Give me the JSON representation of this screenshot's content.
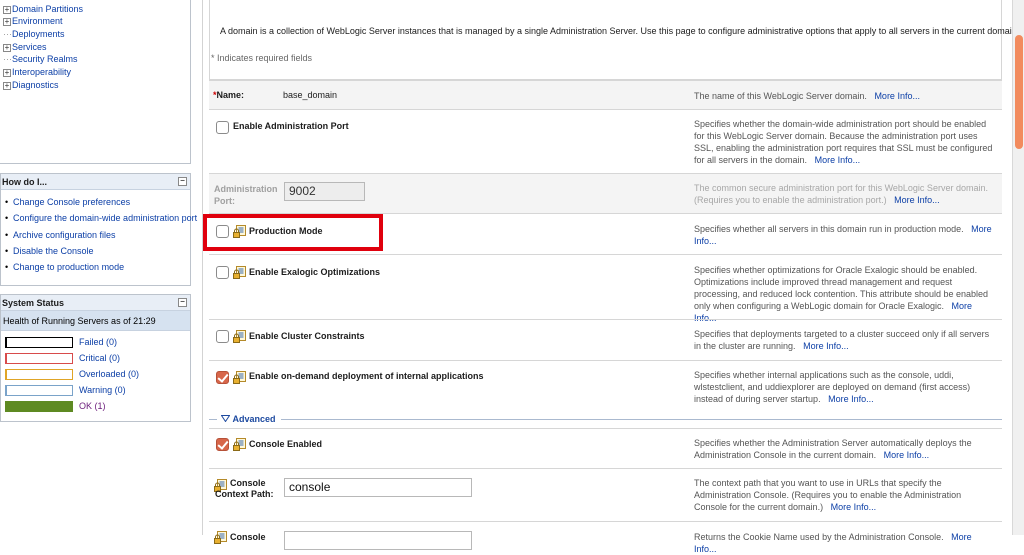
{
  "tree": {
    "items": [
      {
        "label": "Domain Partitions",
        "expandable": true
      },
      {
        "label": "Environment",
        "expandable": true
      },
      {
        "label": "Deployments",
        "expandable": false
      },
      {
        "label": "Services",
        "expandable": true
      },
      {
        "label": "Security Realms",
        "expandable": false
      },
      {
        "label": "Interoperability",
        "expandable": true
      },
      {
        "label": "Diagnostics",
        "expandable": true
      }
    ],
    "expand_glyph": "+",
    "dots_glyph": "···"
  },
  "howdo": {
    "title": "How do I...",
    "collapse_glyph": "−",
    "bullet": "•",
    "links": [
      "Change Console preferences",
      "Configure the domain-wide administration port",
      "Archive configuration files",
      "Disable the Console",
      "Change to production mode"
    ]
  },
  "system_status": {
    "title": "System Status",
    "collapse_glyph": "−",
    "health_label": "Health of Running Servers as of  21:29",
    "rows": [
      {
        "label": "Failed (0)",
        "color": "#000000",
        "fill": 0
      },
      {
        "label": "Critical (0)",
        "color": "#d84b4b",
        "fill": 0
      },
      {
        "label": "Overloaded (0)",
        "color": "#e0a526",
        "fill": 0
      },
      {
        "label": "Warning (0)",
        "color": "#7aa3c9",
        "fill": 0
      },
      {
        "label": "OK (1)",
        "color": "#5e8a22",
        "fill": 1
      }
    ]
  },
  "intro": {
    "text": "A domain is a collection of WebLogic Server instances that is managed by a single Administration Server. Use this page to configure administrative options that apply to all servers in the current domain.",
    "required_note": "* Indicates required fields"
  },
  "more_info": "More Info...",
  "fields": {
    "name": {
      "label": "Name:",
      "required_mark": "*",
      "value": "base_domain",
      "desc": "The name of this WebLogic Server domain."
    },
    "admin_port_enabled": {
      "label": "Enable Administration Port",
      "checked": false,
      "desc": "Specifies whether the domain-wide administration port should be enabled for this WebLogic Server domain. Because the administration port uses SSL, enabling the administration port requires that SSL must be configured for all servers in the domain."
    },
    "admin_port": {
      "label": "Administration Port:",
      "value": "9002",
      "disabled": true,
      "desc": "The common secure administration port for this WebLogic Server domain. (Requires you to enable the administration port.)"
    },
    "production_mode": {
      "label": "Production Mode",
      "checked": false,
      "desc": "Specifies whether all servers in this domain run in production mode."
    },
    "exalogic": {
      "label": "Enable Exalogic Optimizations",
      "checked": false,
      "desc": "Specifies whether optimizations for Oracle Exalogic should be enabled. Optimizations include improved thread management and request processing, and reduced lock contention. This attribute should be enabled only when configuring a WebLogic domain for Oracle Exalogic."
    },
    "cluster_constraints": {
      "label": "Enable Cluster Constraints",
      "checked": false,
      "desc": "Specifies that deployments targeted to a cluster succeed only if all servers in the cluster are running."
    },
    "on_demand": {
      "label": "Enable on-demand deployment of internal applications",
      "checked": true,
      "desc": "Specifies whether internal applications such as the console, uddi, wlstestclient, and uddiexplorer are deployed on demand (first access) instead of during server startup."
    },
    "advanced_label": "Advanced",
    "console_enabled": {
      "label": "Console Enabled",
      "checked": true,
      "desc": "Specifies whether the Administration Server automatically deploys the Administration Console in the current domain."
    },
    "console_context_path": {
      "label": "Console Context Path:",
      "value": "console",
      "desc": "The context path that you want to use in URLs that specify the Administration Console. (Requires you to enable the Administration Console for the current domain.)"
    },
    "console_cookie": {
      "label": "Console",
      "desc": "Returns the Cookie Name used by the Administration Console."
    }
  },
  "colors": {
    "highlight": "#e0000d",
    "checked": "#d7664a",
    "link": "#0b3ea6",
    "scroll_thumb": "#f28b5e"
  },
  "icons": {
    "lock": "lock-icon",
    "advanced_toggle": "chevron-down-icon"
  }
}
